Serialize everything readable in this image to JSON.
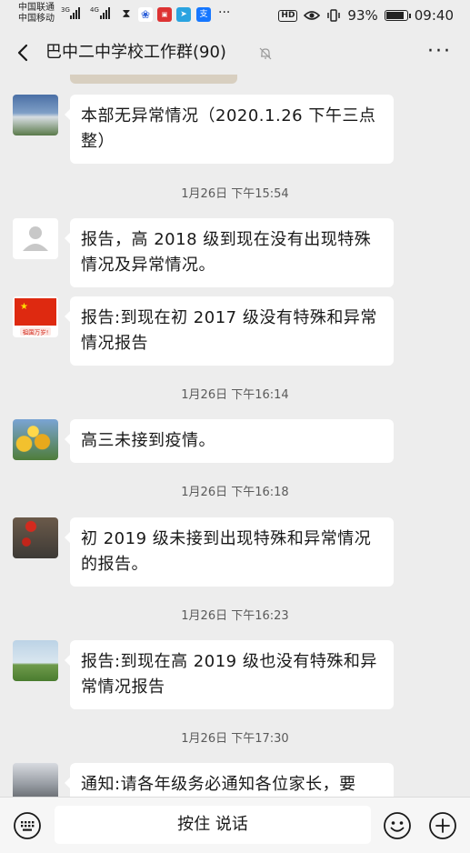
{
  "status_bar": {
    "carrier1": "中国联通",
    "carrier2": "中国移动",
    "net1": "3G",
    "net2": "4G",
    "hd": "HD",
    "battery_pct": "93%",
    "time": "09:40",
    "battery_level": 0.93,
    "app_icons": [
      "alarm-icon",
      "baidu-paw-icon",
      "news-app-icon",
      "telegram-icon",
      "alipay-icon"
    ],
    "more": "···"
  },
  "header": {
    "title": "巴中二中学校工作群(90)",
    "more": "···"
  },
  "messages": [
    {
      "text": "本部无异常情况（2020.1.26 下午三点整）",
      "avatar": "landscape-avatar"
    },
    {
      "text": "报告，高 2018 级到现在没有出现特殊情况及异常情况。",
      "avatar": "default-person-avatar"
    },
    {
      "text": "报告:到现在初 2017 级没有特殊和异常情况报告",
      "avatar": "flag-avatar",
      "avatar_caption": "祖国万岁!"
    },
    {
      "text": "高三未接到疫情。",
      "avatar": "flowers-avatar"
    },
    {
      "text": "初 2019 级未接到出现特殊和异常情况的报告。",
      "avatar": "lantern-avatar"
    },
    {
      "text": "报告:到现在高 2019 级也没有特殊和异常情况报告",
      "avatar": "field-avatar"
    },
    {
      "text": "通知:请各年级务必通知各位家长，要",
      "avatar": "tree-avatar"
    }
  ],
  "timestamps": [
    "1月26日 下午15:54",
    "1月26日 下午16:14",
    "1月26日 下午16:18",
    "1月26日 下午16:23",
    "1月26日 下午17:30"
  ],
  "input_bar": {
    "hold_to_talk": "按住 说话"
  }
}
